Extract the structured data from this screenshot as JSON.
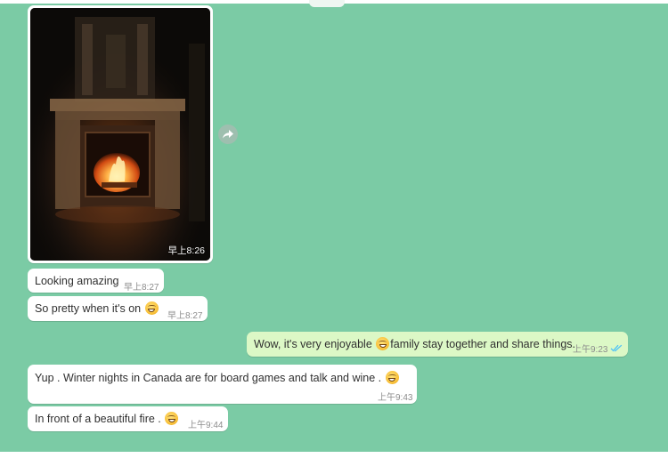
{
  "messages": [
    {
      "type": "image",
      "direction": "incoming",
      "time": "早上8:26",
      "alt": "fireplace"
    },
    {
      "type": "text",
      "direction": "incoming",
      "text": "Looking amazing",
      "time": "早上8:27"
    },
    {
      "type": "text",
      "direction": "incoming",
      "text": "So pretty when it's on",
      "emoji": "grinning",
      "time": "早上8:27"
    },
    {
      "type": "text",
      "direction": "outgoing",
      "text_before": "Wow, it's very enjoyable",
      "emoji": "grinning",
      "text_after": "family stay together and share things.",
      "time": "上午9:23",
      "status": "read"
    },
    {
      "type": "text",
      "direction": "incoming",
      "text": "Yup .  Winter nights in Canada are for board games and talk and wine .",
      "emoji": "grinning",
      "time": "上午9:43"
    },
    {
      "type": "text",
      "direction": "incoming",
      "text": "In front of a beautiful fire .",
      "emoji": "grinning",
      "time": "上午9:44"
    }
  ],
  "colors": {
    "chat_background": "#7bcba5",
    "incoming_bubble": "#ffffff",
    "outgoing_bubble": "#dcf8c6",
    "read_ticks": "#4fc3f7"
  },
  "icons": [
    "forward-icon",
    "double-check-icon",
    "emoji-grinning-icon"
  ]
}
